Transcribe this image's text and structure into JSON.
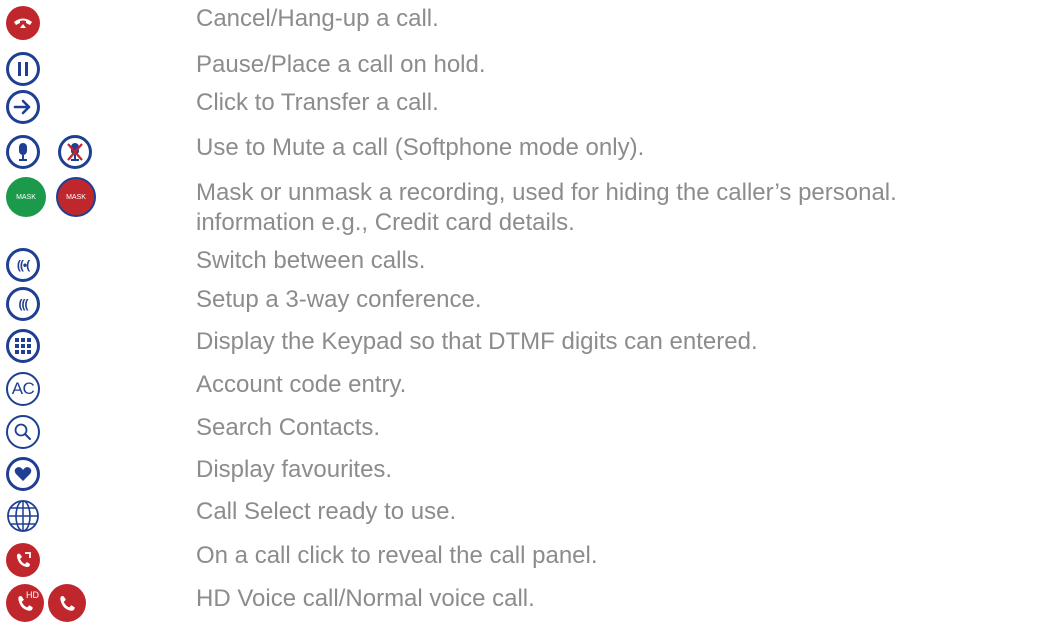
{
  "colors": {
    "red": "#c0272d",
    "green": "#1a9a4a",
    "blue": "#1f3f93",
    "text": "#8c8c8c"
  },
  "rows": [
    {
      "icons": [
        "hang-up-icon"
      ],
      "text": "Cancel/Hang-up a call."
    },
    {
      "icons": [
        "pause-icon"
      ],
      "text": "Pause/Place a call on hold."
    },
    {
      "icons": [
        "transfer-arrow-icon"
      ],
      "text": "Click to Transfer a call."
    },
    {
      "icons": [
        "microphone-icon",
        "microphone-muted-icon"
      ],
      "text": "Use to Mute a call (Softphone mode only)."
    },
    {
      "icons": [
        "mask-green-icon",
        "mask-red-icon"
      ],
      "mask_label": "MASK",
      "text": "Mask or unmask a recording, used for hiding the caller’s personal.",
      "text2": "information e.g., Credit card details."
    },
    {
      "icons": [
        "switch-calls-icon"
      ],
      "switch_label": "((•(",
      "text": "Switch between calls."
    },
    {
      "icons": [
        "conference-icon"
      ],
      "conference_label": "(((",
      "text": "Setup a 3-way conference."
    },
    {
      "icons": [
        "keypad-icon"
      ],
      "text": "Display the Keypad so that DTMF digits can entered."
    },
    {
      "icons": [
        "account-code-icon"
      ],
      "ac_label": "AC",
      "text": "Account code entry."
    },
    {
      "icons": [
        "search-icon"
      ],
      "text": "Search Contacts."
    },
    {
      "icons": [
        "heart-icon"
      ],
      "text": "Display favourites."
    },
    {
      "icons": [
        "globe-icon"
      ],
      "text": "Call Select ready to use."
    },
    {
      "icons": [
        "call-panel-icon"
      ],
      "text": "On a call click to reveal the call panel."
    },
    {
      "icons": [
        "hd-voice-icon",
        "normal-voice-icon"
      ],
      "hd_label": "HD",
      "text": "HD Voice call/Normal voice call."
    }
  ]
}
